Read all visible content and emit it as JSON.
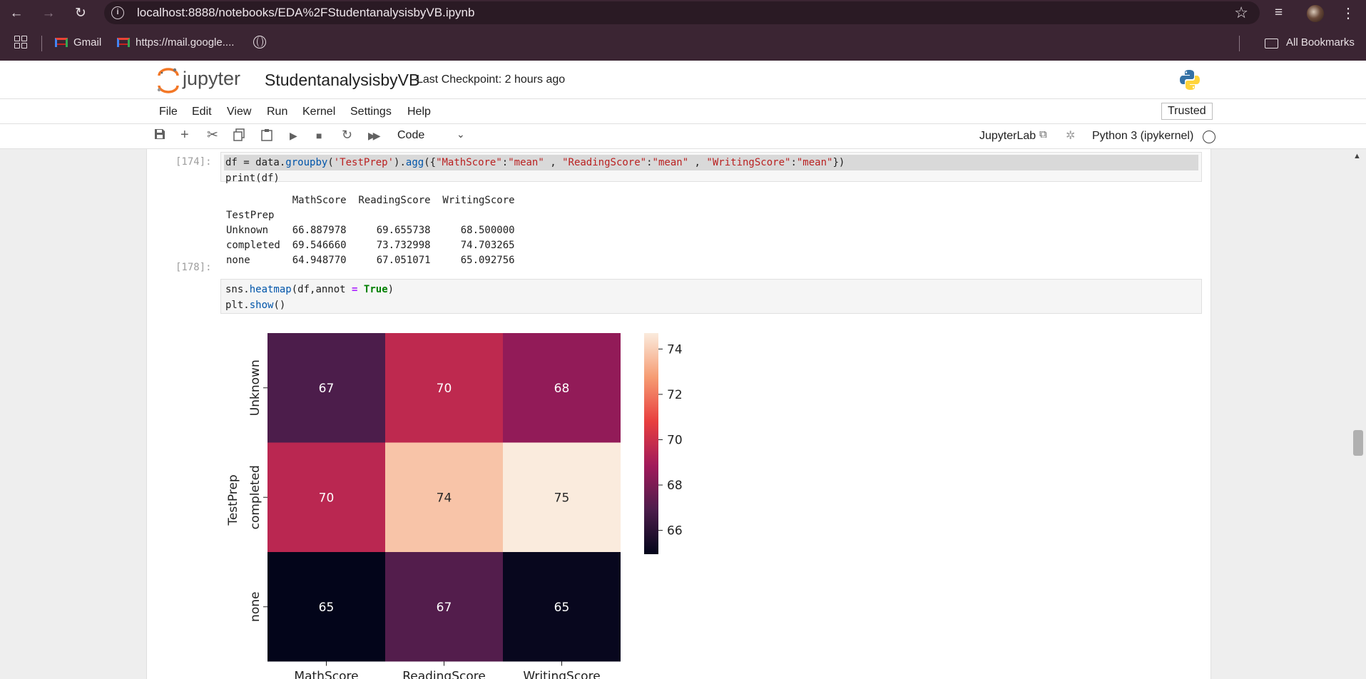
{
  "browser": {
    "url": "localhost:8888/notebooks/EDA%2FStudentanalysisbyVB.ipynb",
    "bookmarks": {
      "gmail": "Gmail",
      "mail": "https://mail.google....",
      "all": "All Bookmarks"
    }
  },
  "jupyter": {
    "logo_text": "jupyter",
    "notebook_title": "StudentanalysisbyVB",
    "checkpoint": "Last Checkpoint: 2 hours ago",
    "menu": [
      "File",
      "Edit",
      "View",
      "Run",
      "Kernel",
      "Settings",
      "Help"
    ],
    "trusted": "Trusted",
    "cell_type": "Code",
    "jupyterlab_link": "JupyterLab",
    "kernel": "Python 3 (ipykernel)"
  },
  "cells": [
    {
      "prompt": "[174]:",
      "output_lines": [
        "           MathScore  ReadingScore  WritingScore",
        "TestPrep                                        ",
        "Unknown    66.887978     69.655738     68.500000",
        "completed  69.546660     73.732998     74.703265",
        "none       64.948770     67.051071     65.092756"
      ]
    },
    {
      "prompt": "[178]:"
    }
  ],
  "chart_data": {
    "type": "heatmap",
    "rows": [
      "Unknown",
      "completed",
      "none"
    ],
    "columns": [
      "MathScore",
      "ReadingScore",
      "WritingScore"
    ],
    "values": [
      [
        66.887978,
        69.655738,
        68.5
      ],
      [
        69.54666,
        73.732998,
        74.703265
      ],
      [
        64.94877,
        67.051071,
        65.092756
      ]
    ],
    "annotations": [
      [
        "67",
        "70",
        "68"
      ],
      [
        "70",
        "74",
        "75"
      ],
      [
        "65",
        "67",
        "65"
      ]
    ],
    "ylabel": "TestPrep",
    "xlabel": "",
    "colorbar_ticks": [
      "74",
      "72",
      "70",
      "68",
      "66"
    ],
    "colorbar_values": [
      74,
      72,
      70,
      68,
      66
    ],
    "vmin": 64.94877,
    "vmax": 74.703265,
    "colormap": "rocket"
  }
}
